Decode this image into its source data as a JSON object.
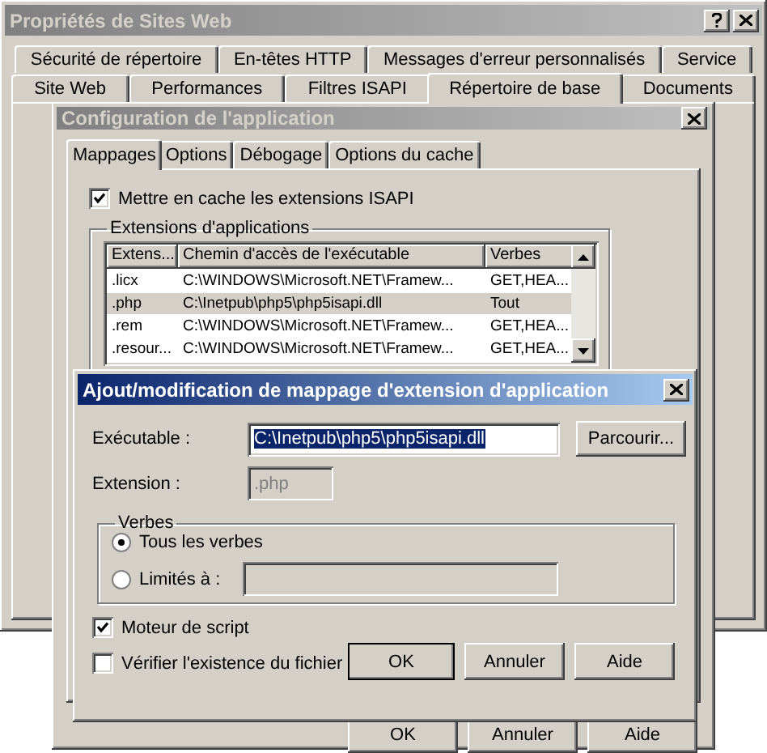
{
  "main_window": {
    "title": "Propriétés de Sites Web",
    "tab_rows": [
      [
        {
          "label": "Sécurité de répertoire",
          "selected": false
        },
        {
          "label": "En-têtes HTTP",
          "selected": false
        },
        {
          "label": "Messages d'erreur personnalisés",
          "selected": false
        },
        {
          "label": "Service",
          "selected": false
        }
      ],
      [
        {
          "label": "Site Web",
          "selected": false
        },
        {
          "label": "Performances",
          "selected": false
        },
        {
          "label": "Filtres ISAPI",
          "selected": false
        },
        {
          "label": "Répertoire de base",
          "selected": true
        },
        {
          "label": "Documents",
          "selected": false
        }
      ]
    ]
  },
  "config_window": {
    "title": "Configuration de l'application",
    "tabs": [
      {
        "label": "Mappages",
        "selected": true
      },
      {
        "label": "Options",
        "selected": false
      },
      {
        "label": "Débogage",
        "selected": false
      },
      {
        "label": "Options du cache",
        "selected": false
      }
    ],
    "cache_checkbox": {
      "label": "Mettre en cache les extensions ISAPI",
      "checked": true
    },
    "group_title": "Extensions d'applications",
    "list": {
      "columns": [
        "Extens...",
        "Chemin d'accès de l'exécutable",
        "Verbes"
      ],
      "rows": [
        {
          "cells": [
            ".licx",
            "C:\\WINDOWS\\Microsoft.NET\\Framew...",
            "GET,HEA..."
          ],
          "selected": false
        },
        {
          "cells": [
            ".php",
            "C:\\Inetpub\\php5\\php5isapi.dll",
            "Tout"
          ],
          "selected": true
        },
        {
          "cells": [
            ".rem",
            "C:\\WINDOWS\\Microsoft.NET\\Framew...",
            "GET,HEA..."
          ],
          "selected": false
        },
        {
          "cells": [
            ".resour...",
            "C:\\WINDOWS\\Microsoft.NET\\Framew...",
            "GET,HEA..."
          ],
          "selected": false
        }
      ]
    },
    "buttons": [
      "OK",
      "Annuler",
      "Aide"
    ]
  },
  "mapping_dialog": {
    "title": "Ajout/modification de mappage d'extension d'application",
    "executable": {
      "label": "Exécutable :",
      "value": "C:\\Inetpub\\php5\\php5isapi.dll"
    },
    "browse_button": "Parcourir...",
    "extension": {
      "label": "Extension :",
      "value": ".php",
      "disabled": true
    },
    "verbs": {
      "title": "Verbes",
      "options": [
        {
          "kind": "plain",
          "label": "Tous les verbes",
          "selected": true
        },
        {
          "kind": "with-field",
          "label": "Limités à :",
          "selected": false
        }
      ]
    },
    "checkboxes": [
      {
        "label": "Moteur de script",
        "checked": true
      },
      {
        "label": "Vérifier l'existence du fichier",
        "checked": false
      }
    ],
    "buttons": [
      {
        "label": "OK",
        "default": true
      },
      {
        "label": "Annuler",
        "default": false
      },
      {
        "label": "Aide",
        "default": false
      }
    ]
  }
}
